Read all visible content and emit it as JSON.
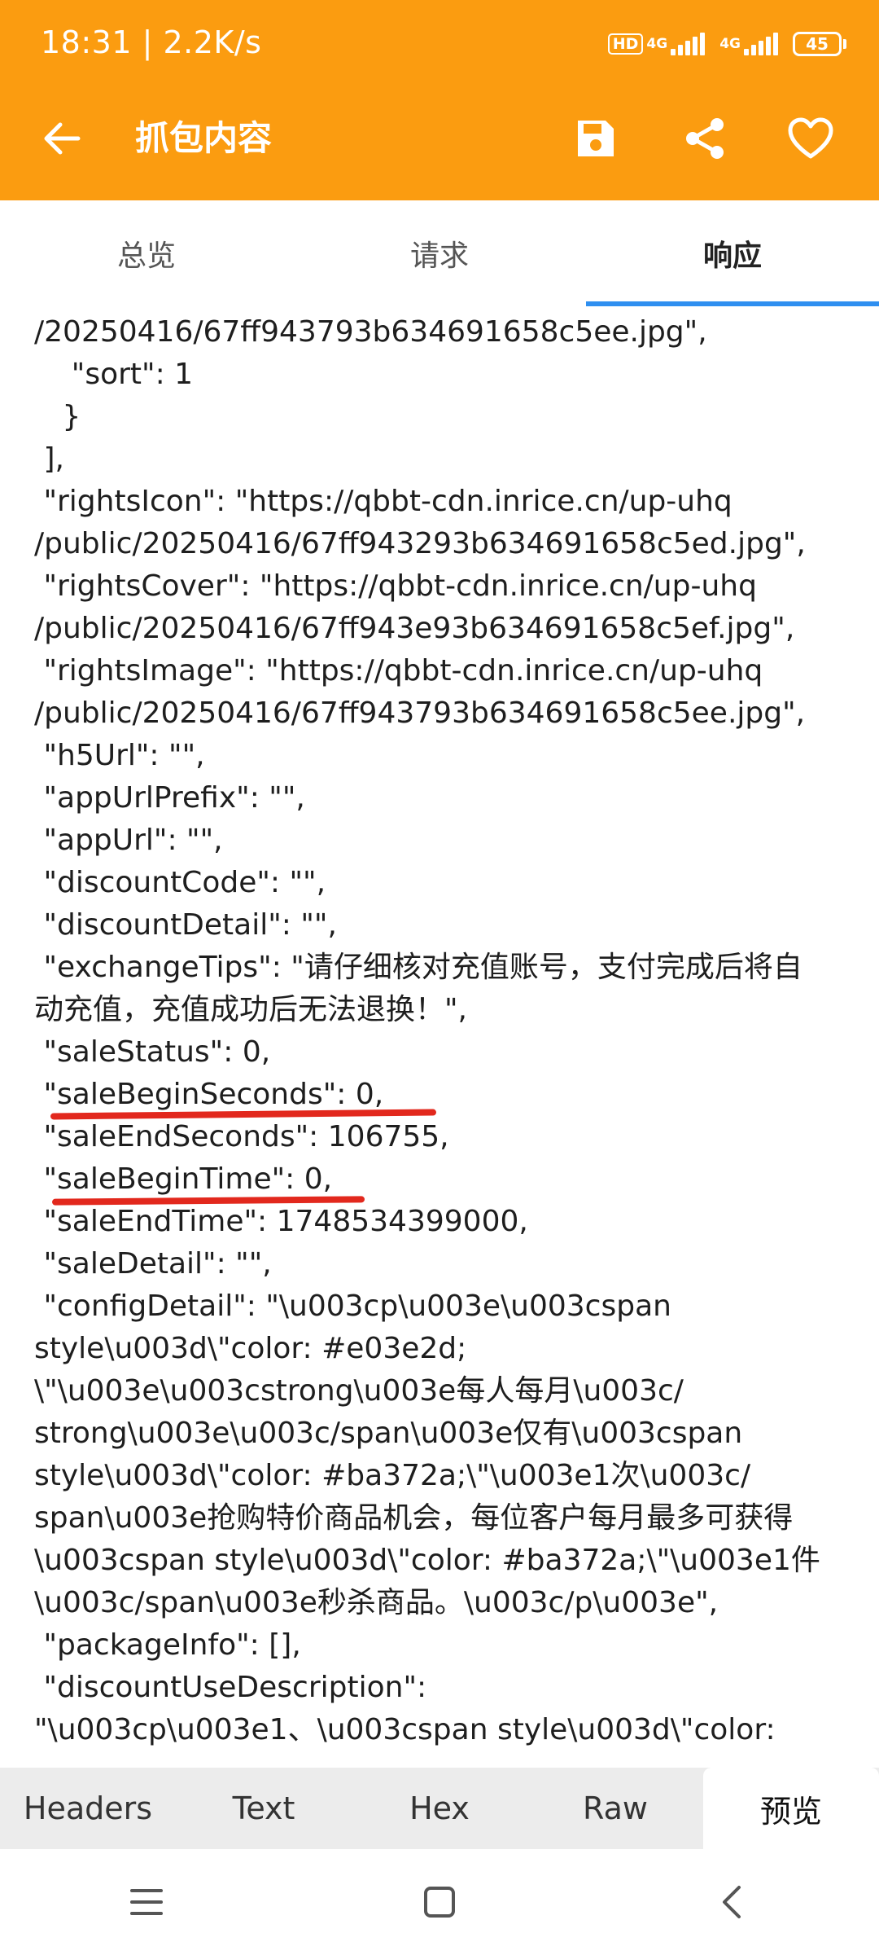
{
  "status_bar": {
    "time_speed": "18:31 | 2.2K/s",
    "hd_label": "HD",
    "network_1": "4G",
    "network_2": "4G",
    "battery": "45"
  },
  "toolbar": {
    "title": "抓包内容",
    "back_icon": "arrow-left-icon",
    "save_icon": "save-icon",
    "share_icon": "share-icon",
    "favorite_icon": "heart-icon"
  },
  "tabs": [
    {
      "label": "总览",
      "active": false
    },
    {
      "label": "请求",
      "active": false
    },
    {
      "label": "响应",
      "active": true
    }
  ],
  "content": {
    "lines": [
      "/20250416/67ff943793b634691658c5ee.jpg\",",
      "    \"sort\": 1",
      "   }",
      " ],",
      " \"rightsIcon\": \"https://qbbt-cdn.inrice.cn/up-uhq",
      "/public/20250416/67ff943293b634691658c5ed.jpg\",",
      " \"rightsCover\": \"https://qbbt-cdn.inrice.cn/up-uhq",
      "/public/20250416/67ff943e93b634691658c5ef.jpg\",",
      " \"rightsImage\": \"https://qbbt-cdn.inrice.cn/up-uhq",
      "/public/20250416/67ff943793b634691658c5ee.jpg\",",
      " \"h5Url\": \"\",",
      " \"appUrlPrefix\": \"\",",
      " \"appUrl\": \"\",",
      " \"discountCode\": \"\",",
      " \"discountDetail\": \"\",",
      " \"exchangeTips\": \"请仔细核对充值账号，支付完成后将自",
      "动充值，充值成功后无法退换！\",",
      " \"saleStatus\": 0,",
      " \"saleBeginSeconds\": 0,",
      " \"saleEndSeconds\": 106755,",
      " \"saleBeginTime\": 0,",
      " \"saleEndTime\": 1748534399000,",
      " \"saleDetail\": \"\",",
      " \"configDetail\": \"\\u003cp\\u003e\\u003cspan",
      "style\\u003d\\\"color: #e03e2d;",
      "\\\"\\u003e\\u003cstrong\\u003e每人每月\\u003c/",
      "strong\\u003e\\u003c/span\\u003e仅有\\u003cspan",
      "style\\u003d\\\"color: #ba372a;\\\"\\u003e1次\\u003c/",
      "span\\u003e抢购特价商品机会，每位客户每月最多可获得",
      "\\u003cspan style\\u003d\\\"color: #ba372a;\\\"\\u003e1件",
      "\\u003c/span\\u003e秒杀商品。\\u003c/p\\u003e\",",
      " \"packageInfo\": [],",
      " \"discountUseDescription\":",
      "\"\\u003cp\\u003e1、\\u003cspan style\\u003d\\\"color:"
    ]
  },
  "bottom_tabs": [
    {
      "label": "Headers",
      "active": false
    },
    {
      "label": "Text",
      "active": false
    },
    {
      "label": "Hex",
      "active": false
    },
    {
      "label": "Raw",
      "active": false
    },
    {
      "label": "预览",
      "active": true
    }
  ],
  "nav": {
    "menu_icon": "menu-icon",
    "home_icon": "home-square-icon",
    "back_icon": "back-chevron-icon"
  },
  "colors": {
    "appbar": "#fb9c10",
    "tab_indicator": "#2f8ff0",
    "annotation": "#e2281d"
  }
}
